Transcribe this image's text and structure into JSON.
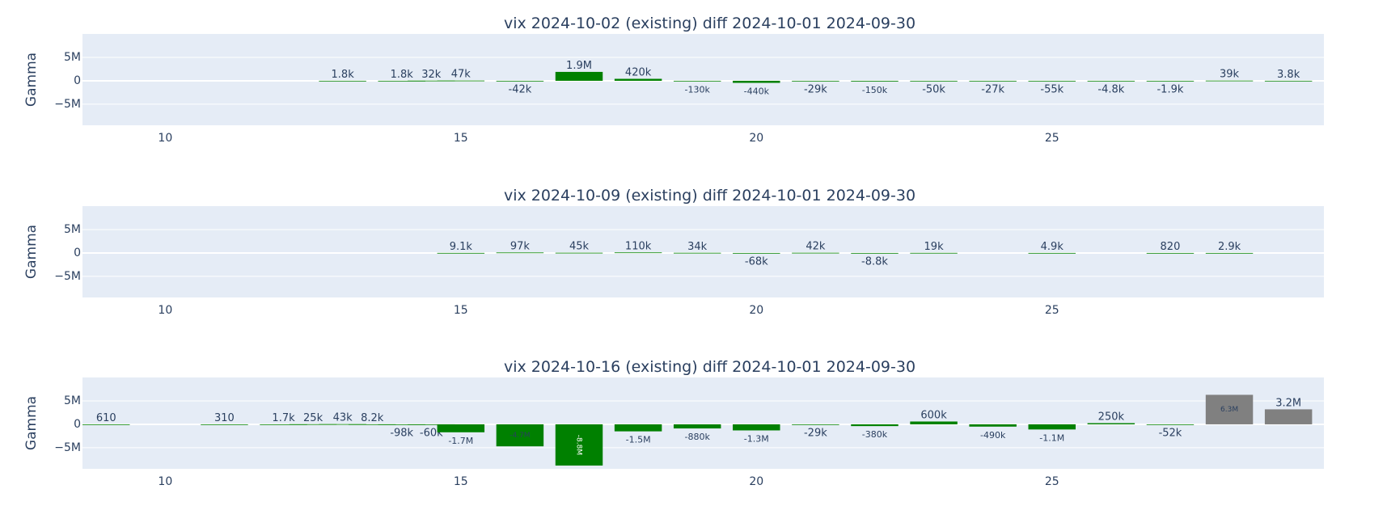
{
  "colors": {
    "plot_bg": "#e5ecf6",
    "grid": "#ffffff",
    "text": "#2a3f5f",
    "positive_bar": "#008000",
    "highlight_bar": "#808080"
  },
  "chart_data": [
    {
      "type": "bar",
      "title": "vix 2024-10-02 (existing) diff 2024-10-01 2024-09-30",
      "ylabel": "Gamma",
      "xlim": [
        8.6,
        29.6
      ],
      "ylim": [
        -9500000,
        10000000
      ],
      "xticks": [
        10,
        15,
        20,
        25
      ],
      "xtick_labels": [
        "10",
        "15",
        "20",
        "25"
      ],
      "yticks": [
        -5000000,
        0,
        5000000
      ],
      "ytick_labels": [
        "−5M",
        "0",
        "5M"
      ],
      "grid": true,
      "legend": "none",
      "x": [
        13,
        14,
        14.5,
        15,
        16,
        17,
        18,
        19,
        20,
        21,
        22,
        23,
        24,
        25,
        26,
        27,
        28,
        29
      ],
      "values": [
        1800,
        1800,
        32000,
        47000,
        -42000,
        1900000,
        420000,
        -130000,
        -440000,
        -29000,
        -150000,
        -50000,
        -27000,
        -55000,
        -4800,
        -1900,
        39000,
        3800
      ],
      "labels": [
        "1.8k",
        "1.8k",
        "32k",
        "47k",
        "-42k",
        "1.9M",
        "420k",
        "-130k",
        "-440k",
        "-29k",
        "-150k",
        "-50k",
        "-27k",
        "-55k",
        "-4.8k",
        "-1.9k",
        "39k",
        "3.8k"
      ],
      "bar_colors": [
        "green",
        "green",
        "green",
        "green",
        "green",
        "green",
        "green",
        "green",
        "green",
        "green",
        "green",
        "green",
        "green",
        "green",
        "green",
        "green",
        "green",
        "green"
      ]
    },
    {
      "type": "bar",
      "title": "vix 2024-10-09 (existing) diff 2024-10-01 2024-09-30",
      "ylabel": "Gamma",
      "xlim": [
        8.6,
        29.6
      ],
      "ylim": [
        -9500000,
        10000000
      ],
      "xticks": [
        10,
        15,
        20,
        25
      ],
      "xtick_labels": [
        "10",
        "15",
        "20",
        "25"
      ],
      "yticks": [
        -5000000,
        0,
        5000000
      ],
      "ytick_labels": [
        "−5M",
        "0",
        "5M"
      ],
      "grid": true,
      "legend": "none",
      "x": [
        15,
        16,
        17,
        18,
        19,
        20,
        21,
        22,
        23,
        25,
        27,
        28
      ],
      "values": [
        9100,
        97000,
        45000,
        110000,
        34000,
        -68000,
        42000,
        -8800,
        19000,
        4900,
        820,
        2900
      ],
      "labels": [
        "9.1k",
        "97k",
        "45k",
        "110k",
        "34k",
        "-68k",
        "42k",
        "-8.8k",
        "19k",
        "4.9k",
        "820",
        "2.9k"
      ],
      "bar_colors": [
        "green",
        "green",
        "green",
        "green",
        "green",
        "green",
        "green",
        "green",
        "green",
        "green",
        "green",
        "green"
      ]
    },
    {
      "type": "bar",
      "title": "vix 2024-10-16 (existing) diff 2024-10-01 2024-09-30",
      "ylabel": "Gamma",
      "xlim": [
        8.6,
        29.6
      ],
      "ylim": [
        -9500000,
        10000000
      ],
      "xticks": [
        10,
        15,
        20,
        25
      ],
      "xtick_labels": [
        "10",
        "15",
        "20",
        "25"
      ],
      "yticks": [
        -5000000,
        0,
        5000000
      ],
      "ytick_labels": [
        "−5M",
        "0",
        "5M"
      ],
      "grid": true,
      "legend": "none",
      "x": [
        9,
        11,
        12,
        12.5,
        13,
        13.5,
        14,
        14.5,
        15,
        16,
        17,
        18,
        19,
        20,
        21,
        22,
        23,
        24,
        25,
        26,
        27,
        28,
        29
      ],
      "values": [
        610,
        310,
        1700,
        25000,
        43000,
        8200,
        -98000,
        -60000,
        -1700000,
        -4700000,
        -8800000,
        -1500000,
        -880000,
        -1300000,
        -29000,
        -380000,
        600000,
        -490000,
        -1100000,
        250000,
        -52000,
        6300000,
        3200000
      ],
      "labels": [
        "610",
        "310",
        "1.7k",
        "25k",
        "43k",
        "8.2k",
        "-98k",
        "-60k",
        "-1.7M",
        "-4.7M",
        "-8.8M",
        "-1.5M",
        "-880k",
        "-1.3M",
        "-29k",
        "-380k",
        "600k",
        "-490k",
        "-1.1M",
        "250k",
        "-52k",
        "6.3M",
        "3.2M"
      ],
      "bar_colors": [
        "green",
        "green",
        "green",
        "green",
        "green",
        "green",
        "green",
        "green",
        "green",
        "green",
        "green",
        "green",
        "green",
        "green",
        "green",
        "green",
        "green",
        "green",
        "green",
        "green",
        "green",
        "gray",
        "gray"
      ]
    }
  ]
}
